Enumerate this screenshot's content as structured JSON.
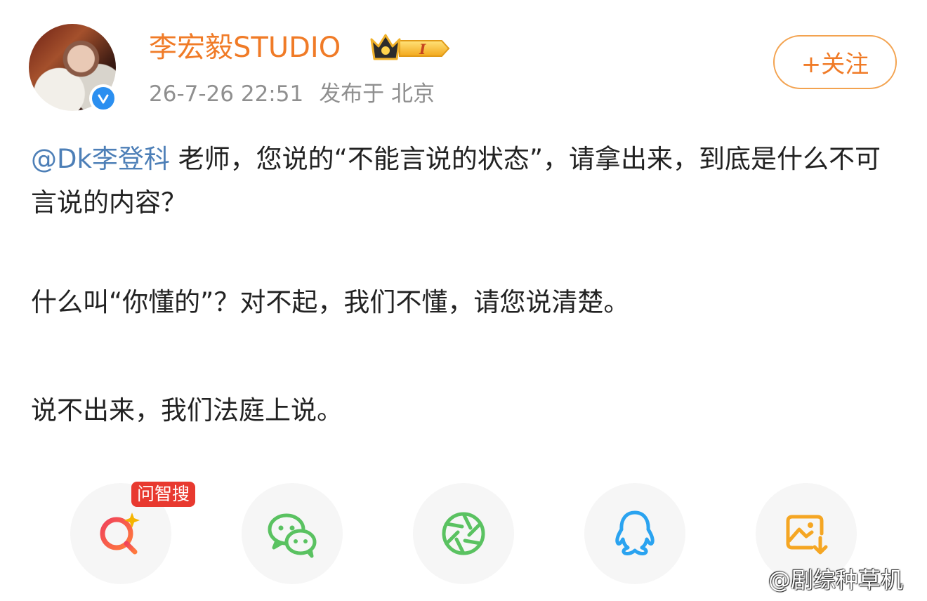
{
  "header": {
    "username": "李宏毅STUDIO",
    "badge_level": "I",
    "timestamp": "26-7-26 22:51",
    "location_prefix": "发布于",
    "location": "北京",
    "follow_label": "+关注"
  },
  "post": {
    "mention": "@Dk李登科",
    "paragraph1_rest": "老师，您说的“不能言说的状态”，请拿出来，到底是什么不可言说的内容？",
    "paragraph2": "什么叫“你懂的”？对不起，我们不懂，请您说清楚。",
    "paragraph3": "说不出来，我们法庭上说。"
  },
  "actions": {
    "ai_search_tag": "问智搜",
    "items": [
      "search-ai",
      "wechat",
      "moments",
      "qq",
      "save-image"
    ]
  },
  "watermark": "@剧综种草机",
  "colors": {
    "accent_orange": "#f07b27",
    "mention_blue": "#4d7fb7",
    "verified_blue": "#2b8ff0",
    "tag_red": "#e8392f",
    "wechat_green": "#5ac261",
    "qq_blue": "#2aa3f0",
    "save_orange": "#f5a623"
  }
}
